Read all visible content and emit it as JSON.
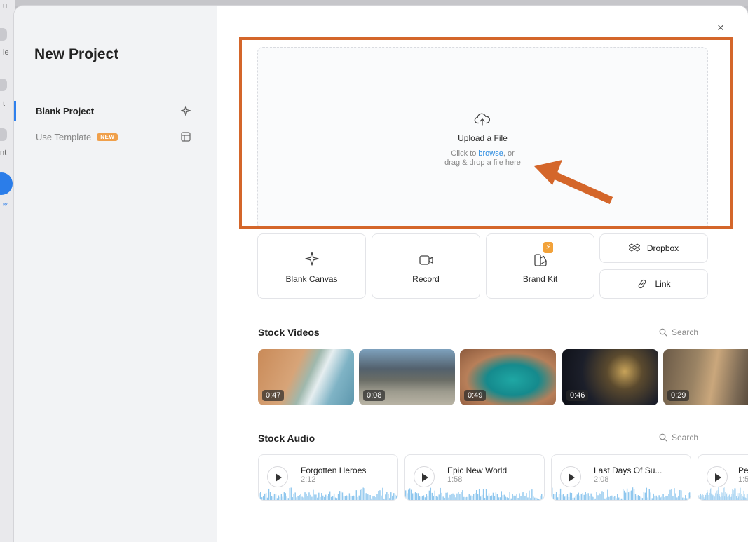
{
  "background_app": {
    "fragments": [
      "u",
      "le",
      "t",
      "nt",
      "w"
    ]
  },
  "modal": {
    "title": "New Project",
    "close_label": "×",
    "sidebar": [
      {
        "label": "Blank Project",
        "active": true,
        "icon": "sparkle-icon"
      },
      {
        "label": "Use Template",
        "badge": "NEW",
        "active": false,
        "icon": "layout-icon"
      }
    ],
    "upload": {
      "title": "Upload a File",
      "line1_prefix": "Click to ",
      "browse_label": "browse",
      "line1_suffix": ", or",
      "line2": "drag & drop a file here",
      "icon": "cloud-upload-icon"
    },
    "actions": {
      "blank_canvas": "Blank Canvas",
      "record": "Record",
      "brand_kit": "Brand Kit",
      "brand_kit_badge": "⚡",
      "dropbox": "Dropbox",
      "link": "Link"
    },
    "stock_videos": {
      "title": "Stock Videos",
      "search_label": "Search",
      "items": [
        {
          "duration": "0:47",
          "theme": "beach-aerial"
        },
        {
          "duration": "0:08",
          "theme": "mountains"
        },
        {
          "duration": "0:49",
          "theme": "lagoon-aerial"
        },
        {
          "duration": "0:46",
          "theme": "city-night"
        },
        {
          "duration": "0:29",
          "theme": "musicians"
        }
      ]
    },
    "stock_audio": {
      "title": "Stock Audio",
      "search_label": "Search",
      "items": [
        {
          "title": "Forgotten Heroes",
          "duration": "2:12"
        },
        {
          "title": "Epic New World",
          "duration": "1:58"
        },
        {
          "title": "Last Days Of Su...",
          "duration": "2:08"
        },
        {
          "title": "Pe",
          "duration": "1:5"
        }
      ]
    }
  },
  "colors": {
    "accent": "#2f80ed",
    "annotation": "#d4662a",
    "waveform": "#8fc7ee",
    "badge": "#f0a04b"
  }
}
